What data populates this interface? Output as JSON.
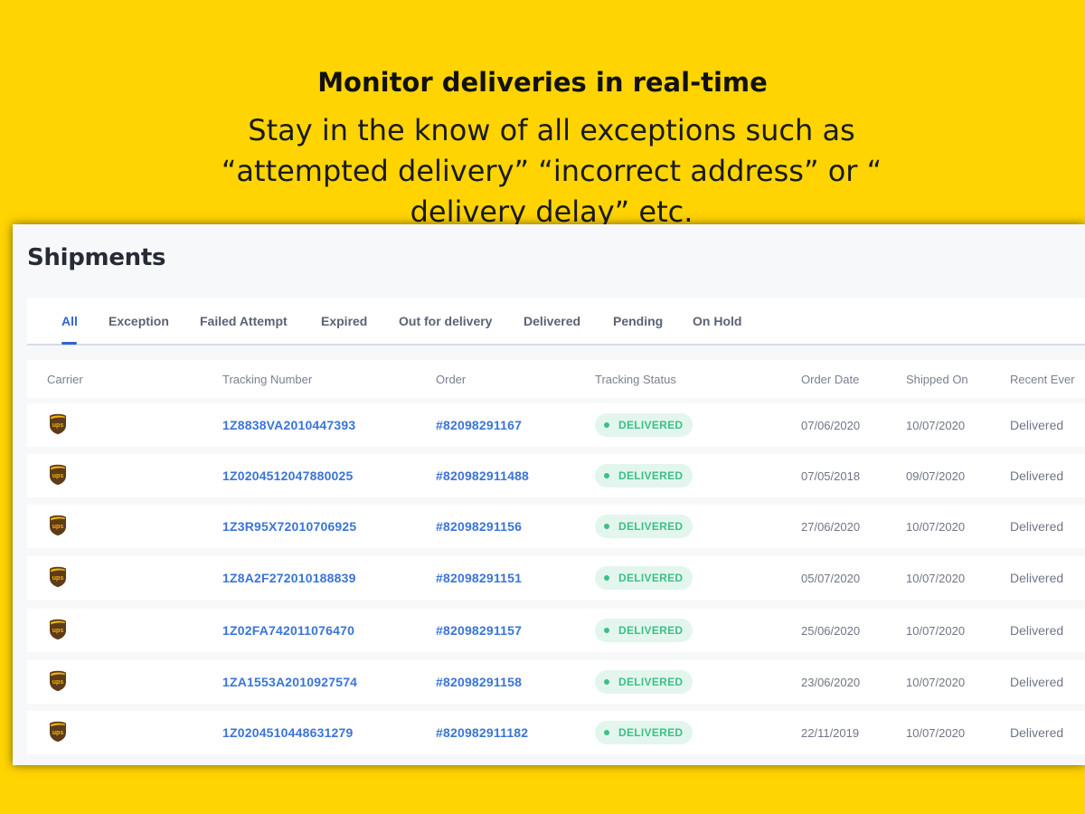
{
  "banner": {
    "headline": "Monitor deliveries in real-time",
    "subline": "Stay in the know of all exceptions such as “attempted delivery” “incorrect address” or “ delivery delay” etc."
  },
  "page": {
    "title": "Shipments"
  },
  "tabs": [
    "All",
    "Exception",
    "Failed Attempt",
    "Expired",
    "Out for delivery",
    "Delivered",
    "Pending",
    "On Hold"
  ],
  "active_tab": "All",
  "table": {
    "columns": [
      "Carrier",
      "Tracking Number",
      "Order",
      "Tracking Status",
      "Order Date",
      "Shipped On",
      "Recent Ever"
    ],
    "rows": [
      {
        "carrier": "ups",
        "tracking": "1Z8838VA2010447393",
        "order": "#82098291167",
        "status": "DELIVERED",
        "order_date": "07/06/2020",
        "shipped_on": "10/07/2020",
        "recent_event": "Delivered"
      },
      {
        "carrier": "ups",
        "tracking": "1Z0204512047880025",
        "order": "#820982911488",
        "status": "DELIVERED",
        "order_date": "07/05/2018",
        "shipped_on": "09/07/2020",
        "recent_event": "Delivered"
      },
      {
        "carrier": "ups",
        "tracking": "1Z3R95X72010706925",
        "order": "#82098291156",
        "status": "DELIVERED",
        "order_date": "27/06/2020",
        "shipped_on": "10/07/2020",
        "recent_event": "Delivered"
      },
      {
        "carrier": "ups",
        "tracking": "1Z8A2F272010188839",
        "order": "#82098291151",
        "status": "DELIVERED",
        "order_date": "05/07/2020",
        "shipped_on": "10/07/2020",
        "recent_event": "Delivered"
      },
      {
        "carrier": "ups",
        "tracking": "1Z02FA742011076470",
        "order": "#82098291157",
        "status": "DELIVERED",
        "order_date": "25/06/2020",
        "shipped_on": "10/07/2020",
        "recent_event": "Delivered"
      },
      {
        "carrier": "ups",
        "tracking": "1ZA1553A2010927574",
        "order": "#82098291158",
        "status": "DELIVERED",
        "order_date": "23/06/2020",
        "shipped_on": "10/07/2020",
        "recent_event": "Delivered"
      },
      {
        "carrier": "ups",
        "tracking": "1Z0204510448631279",
        "order": "#820982911182",
        "status": "DELIVERED",
        "order_date": "22/11/2019",
        "shipped_on": "10/07/2020",
        "recent_event": "Delivered"
      }
    ]
  },
  "colors": {
    "background": "#FFD400",
    "accent": "#2f66d0",
    "link": "#3a74d8",
    "status_delivered": "#3dbf86",
    "ups_brown": "#5e3b1a",
    "ups_gold": "#f2b705"
  }
}
